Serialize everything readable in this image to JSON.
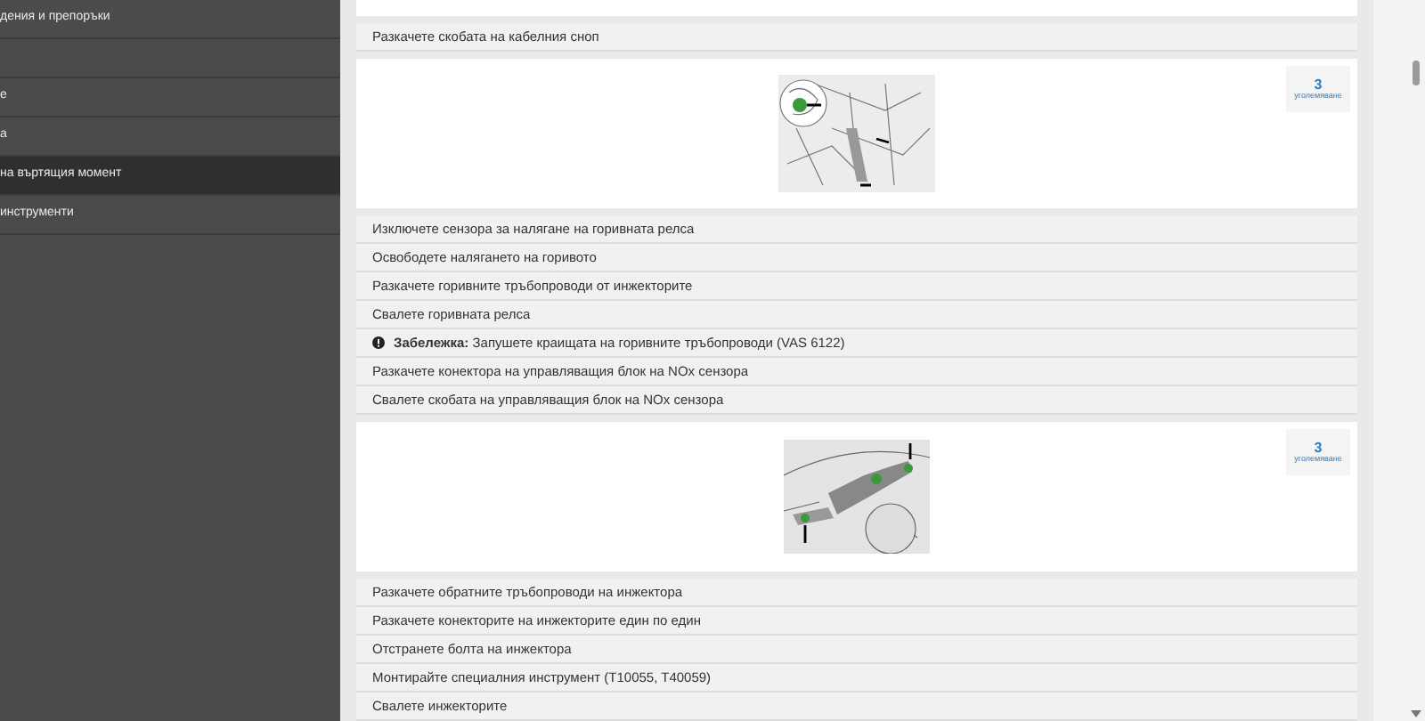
{
  "sidebar": {
    "items": [
      {
        "label": "дения и препоръки",
        "selected": false
      },
      {
        "selected": false
      },
      {
        "label": "е",
        "selected": false
      },
      {
        "label": "а",
        "selected": false
      },
      {
        "label": "на въртящия момент",
        "selected": true
      },
      {
        "label": "инструменти",
        "selected": false
      }
    ]
  },
  "steps": [
    {
      "kind": "step",
      "text": "Разкачете скобата на кабелния сноп"
    },
    {
      "kind": "image",
      "badge_number": "3",
      "badge_label": "уголемяване"
    },
    {
      "kind": "step",
      "text": "Изключете сензора за налягане на горивната релса"
    },
    {
      "kind": "step",
      "text": "Освободете налягането на горивото"
    },
    {
      "kind": "step",
      "text": "Разкачете горивните тръбопроводи от инжекторите"
    },
    {
      "kind": "step",
      "text": "Свалете горивната релса"
    },
    {
      "kind": "note",
      "text": "**Забележка:** Запушете краищата на горивните тръбопроводи (VAS 6122)"
    },
    {
      "kind": "step",
      "text": "Разкачете конектора на управляващия блок на NOx сензора"
    },
    {
      "kind": "step",
      "text": "Свалете скобата на управляващия блок на NOx сензора"
    },
    {
      "kind": "image",
      "badge_number": "3",
      "badge_label": "уголемяване"
    },
    {
      "kind": "step",
      "text": "Разкачете обратните тръбопроводи на инжектора"
    },
    {
      "kind": "step",
      "text": "Разкачете конекторите на инжекторите един по един"
    },
    {
      "kind": "step",
      "text": "Отстранете болта на инжектора"
    },
    {
      "kind": "step",
      "text": "Монтирайте специалния инструмент (T10055, T40059)"
    },
    {
      "kind": "step",
      "text": "Свалете инжекторите"
    }
  ]
}
